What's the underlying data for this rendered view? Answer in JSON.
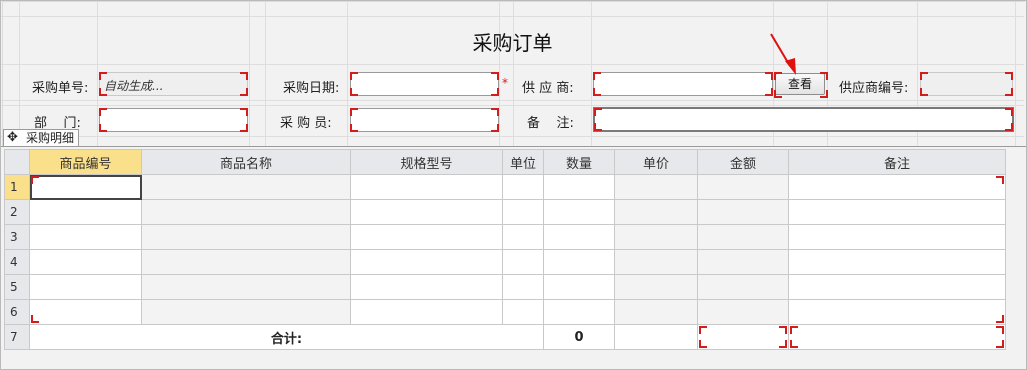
{
  "title": "采购订单",
  "header": {
    "row1": {
      "order_no_label": "采购单号:",
      "order_no_value": "自动生成...",
      "date_label": "采购日期:",
      "date_required": "*",
      "supplier_label": "供 应 商:",
      "view_button": "查看",
      "supplier_code_label": "供应商编号:"
    },
    "row2": {
      "dept_label": "部    门:",
      "buyer_label": "采 购 员:",
      "remark_label": "备    注:"
    }
  },
  "detail": {
    "tab_label": "采购明细",
    "move_icon": "move-icon",
    "columns": [
      "商品编号",
      "商品名称",
      "规格型号",
      "单位",
      "数量",
      "单价",
      "金额",
      "备注"
    ],
    "row_numbers": [
      "1",
      "2",
      "3",
      "4",
      "5",
      "6"
    ],
    "total_row_number": "7",
    "total_label": "合计:",
    "total_quantity": "0"
  },
  "colors": {
    "required_corner": "#d21d1d",
    "selected_header": "#fbe08c",
    "annotation_arrow": "#e01010"
  }
}
